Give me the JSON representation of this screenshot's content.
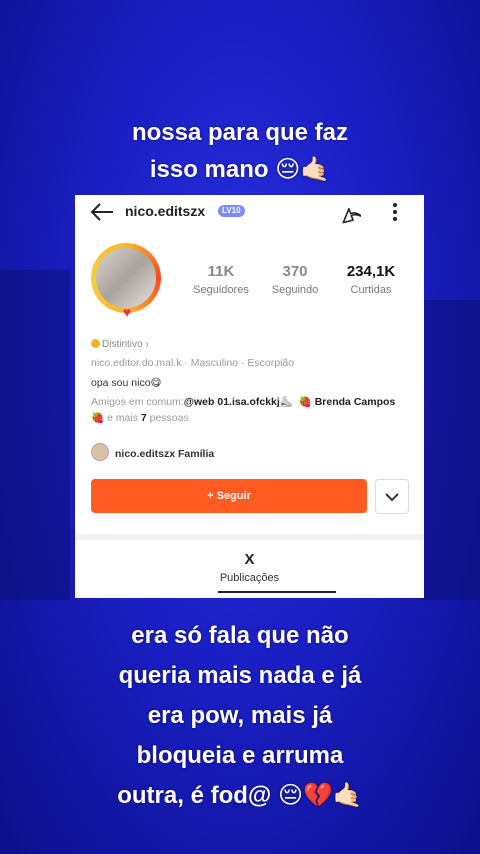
{
  "overlay": {
    "top_line1": "nossa para que faz",
    "top_line2": "isso mano 😔🤙🏻",
    "bottom_line1": "era só fala que não",
    "bottom_line2": "queria mais nada e já",
    "bottom_line3": "era pow, mais já",
    "bottom_line4": "bloqueia e arruma",
    "bottom_line5": "outra, é fod@ 😔💔🤙🏻"
  },
  "profile": {
    "username": "nico.editszx",
    "level_badge": "LV10",
    "stats": {
      "followers_value": "11K",
      "followers_label": "Seguidores",
      "following_value": "370",
      "following_label": "Seguindo",
      "likes_value": "234,1K",
      "likes_label": "Curtidas"
    },
    "badge_label": "Distintivo ›",
    "info": "nico.editor.do.mal.k · Masculino · Escorpião",
    "bio": "opa sou nico😋",
    "friends_prefix": "Amigos em comum:",
    "friend1": "@web 01.isa.ofckkj⛸️",
    "friend2": "🍓 Brenda Campos 🍓",
    "friends_suffix": " e mais ",
    "friends_count": "7",
    "friends_end": " pessoas",
    "family": "nico.editszx Família",
    "follow_button": "+ Seguir",
    "tab_icon": "X",
    "tab_label": "Publicações"
  },
  "icons": {
    "back": "arrow-left",
    "share": "share-arrow",
    "more": "vertical-dots",
    "dropdown": "chevron-down"
  },
  "colors": {
    "accent": "#ff5a1f",
    "background": "#1a1fc4",
    "level_badge": "#7b8cf7"
  }
}
